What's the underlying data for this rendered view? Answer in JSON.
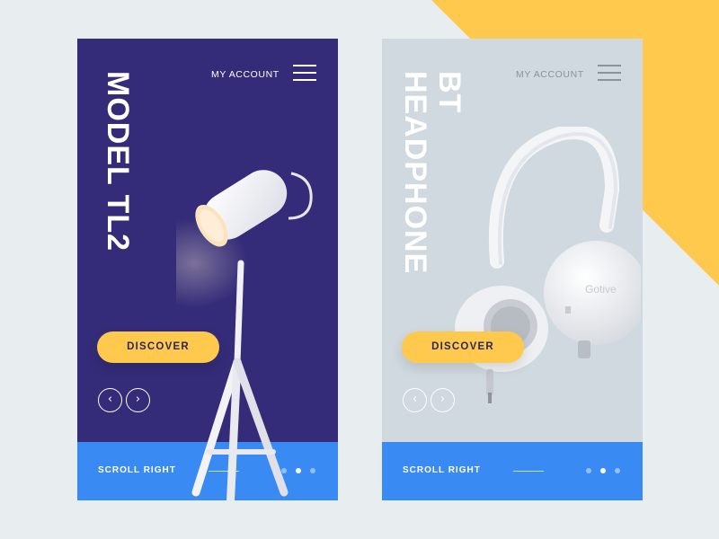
{
  "colors": {
    "background": "#e8edf0",
    "accent_yellow": "#ffc94d",
    "card1_bg": "#342c78",
    "card2_bg": "#d0d9e0",
    "footer_blue": "#3a8af3"
  },
  "cards": [
    {
      "account_label": "MY ACCOUNT",
      "title": "MODEL TL2",
      "discover_label": "DISCOVER",
      "prev_icon": "‹",
      "next_icon": "›",
      "footer_label": "SCROLL RIGHT",
      "page_indicator": {
        "total": 3,
        "active": 2
      },
      "product_icon": "desk-lamp-icon"
    },
    {
      "account_label": "MY ACCOUNT",
      "title_lines": [
        "BT",
        "HEADPHONE"
      ],
      "discover_label": "DISCOVER",
      "prev_icon": "‹",
      "next_icon": "›",
      "footer_label": "SCROLL RIGHT",
      "page_indicator": {
        "total": 3,
        "active": 2
      },
      "product_brand": "Gotive",
      "product_icon": "headphones-icon"
    }
  ]
}
